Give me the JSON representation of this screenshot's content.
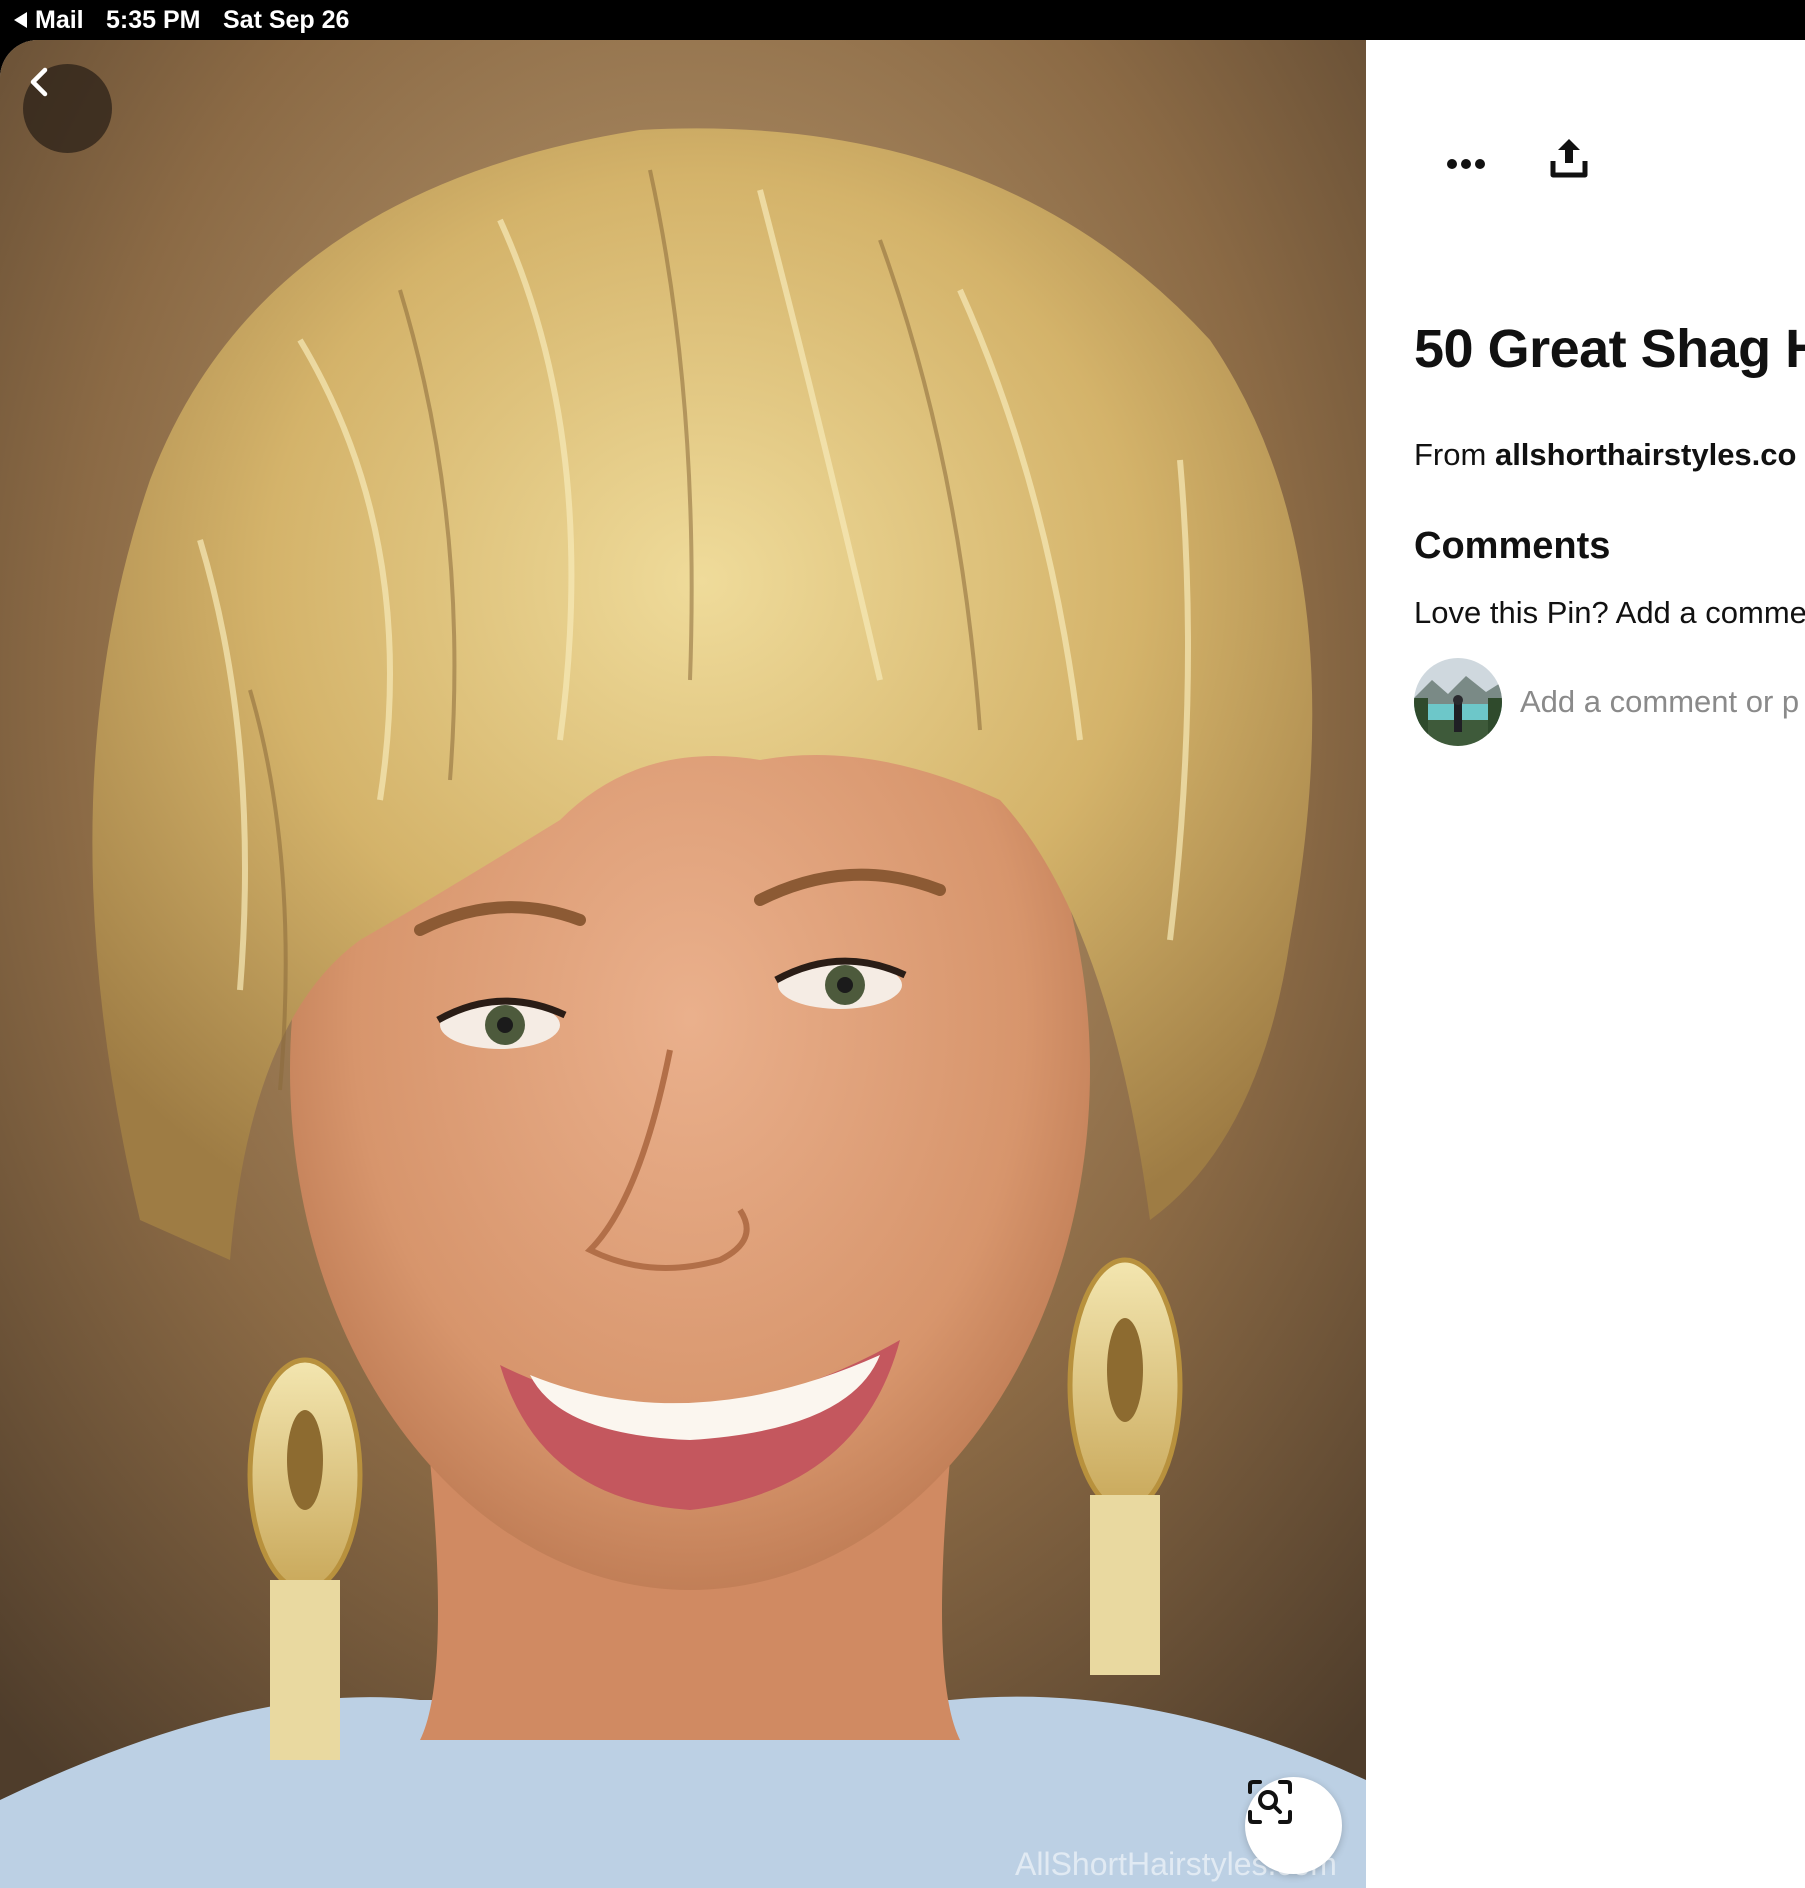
{
  "status_bar": {
    "back_app": "Mail",
    "time": "5:35 PM",
    "date": "Sat Sep 26"
  },
  "image": {
    "icon_back": "chevron-left-icon",
    "icon_lens": "visual-search-icon",
    "watermark": "AllShortHairstyles.com"
  },
  "actions": {
    "icon_more": "more-dots-icon",
    "icon_share": "share-upload-icon"
  },
  "pin": {
    "title": "50 Great Shag H",
    "source_prefix": "From",
    "source_domain": "allshorthairstyles.co"
  },
  "comments": {
    "heading": "Comments",
    "prompt": "Love this Pin? Add a comme",
    "input_placeholder": "Add a comment or p"
  },
  "colors": {
    "text": "#111111",
    "placeholder": "#8a8a8a",
    "back_button_bg": "#281e16"
  }
}
